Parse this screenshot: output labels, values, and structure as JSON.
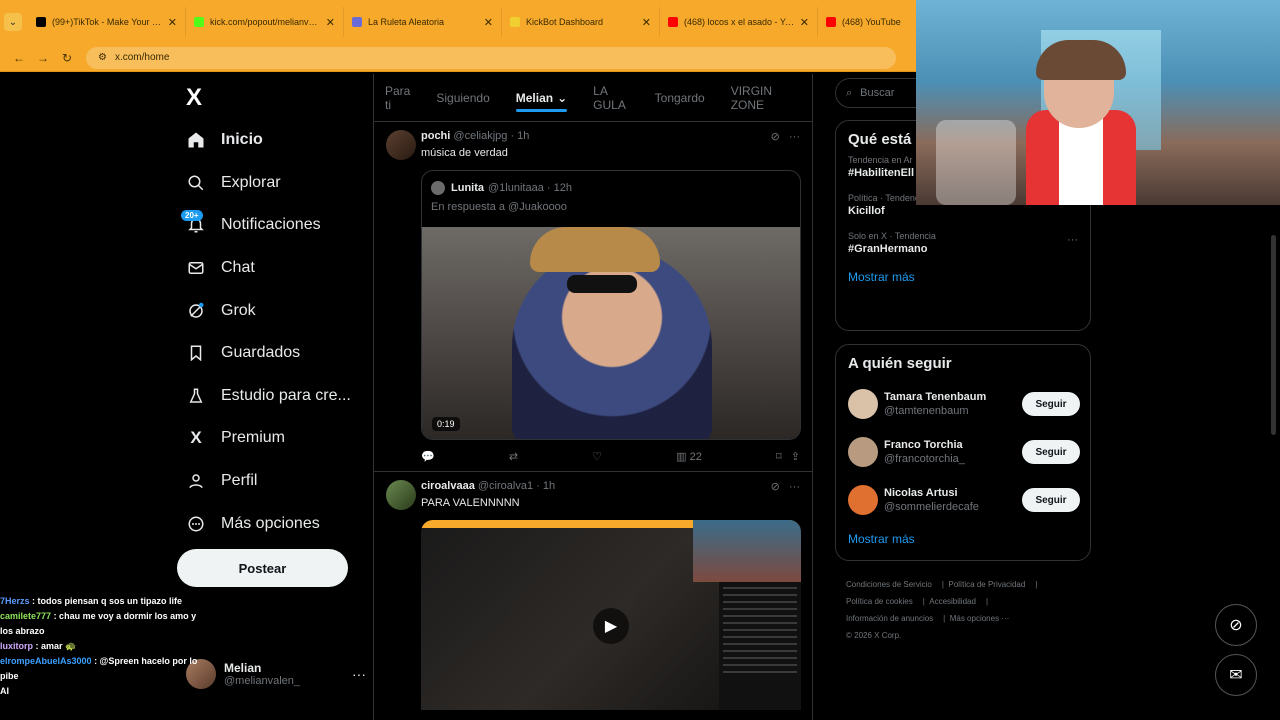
{
  "browser": {
    "tabs": [
      {
        "title": "(99+)TikTok - Make Your Day",
        "color": "#000000"
      },
      {
        "title": "kick.com/popout/melianvalen/",
        "color": "#53fc18"
      },
      {
        "title": "La Ruleta Aleatoria",
        "color": "#6b6bd8"
      },
      {
        "title": "KickBot Dashboard",
        "color": "#f0d030"
      },
      {
        "title": "(468) locos x el asado - YouTube",
        "color": "#ff0000"
      },
      {
        "title": "(468) YouTube",
        "color": "#ff0000"
      }
    ],
    "url": "x.com/home"
  },
  "sidebar": {
    "logo": "X",
    "items": [
      {
        "label": "Inicio",
        "icon": "home-icon",
        "glyph": "⌂"
      },
      {
        "label": "Explorar",
        "icon": "search-icon",
        "glyph": "⌕"
      },
      {
        "label": "Notificaciones",
        "icon": "bell-icon",
        "glyph": "🔔",
        "badge": "20+"
      },
      {
        "label": "Chat",
        "icon": "mail-icon",
        "glyph": "✉"
      },
      {
        "label": "Grok",
        "icon": "grok-icon",
        "glyph": "⊘"
      },
      {
        "label": "Guardados",
        "icon": "bookmark-icon",
        "glyph": "⌑"
      },
      {
        "label": "Estudio para cre...",
        "icon": "flask-icon",
        "glyph": "⚗"
      },
      {
        "label": "Premium",
        "icon": "x-logo-icon",
        "glyph": "X"
      },
      {
        "label": "Perfil",
        "icon": "person-icon",
        "glyph": "👤"
      },
      {
        "label": "Más opciones",
        "icon": "more-circle-icon",
        "glyph": "⋯"
      }
    ],
    "post_label": "Postear",
    "profile": {
      "name": "Melian",
      "handle": "@melianvalen_",
      "more": "···"
    }
  },
  "chat_overlay": [
    {
      "user": "7Herzs",
      "text": ": todos piensan q sos un tipazo life"
    },
    {
      "user": "camilete777",
      "text": ": chau me voy a dormir los amo y los abrazo"
    },
    {
      "user": "luxitorp",
      "text": ": amar 🐢"
    },
    {
      "user": "elrompeAbuelAs3000",
      "text": ": @Spreen hacelo por lo pibe"
    },
    {
      "user": "",
      "text": "AI"
    }
  ],
  "feed": {
    "tabs": [
      "Para ti",
      "Siguiendo",
      "Melian",
      "LA GULA",
      "Tongardo",
      "VIRGIN ZONE"
    ],
    "active_tab": "Melian",
    "tweets": [
      {
        "name": "pochi",
        "handle": "@celiakjpg",
        "time": "· 1h",
        "text": "música de verdad",
        "quote": {
          "name": "Lunita",
          "handle": "@1lunitaaa",
          "time": "· 12h",
          "reply": "En respuesta a @Juakoooo",
          "duration": "0:19"
        },
        "actions": {
          "reply": "",
          "repost": "",
          "like": "",
          "views": "22"
        }
      },
      {
        "name": "ciroalvaaa",
        "handle": "@ciroalva1",
        "time": "· 1h",
        "text": "PARA VALENNNNN"
      }
    ]
  },
  "right": {
    "search_placeholder": "Buscar",
    "trends_title": "Qué está p",
    "trends": [
      {
        "category": "Tendencia en Ar",
        "name": "#HabilitenEll"
      },
      {
        "category": "Política · Tendencia",
        "name": "Kicillof"
      },
      {
        "category": "Solo en X · Tendencia",
        "name": "#GranHermano"
      }
    ],
    "trends_more": "Mostrar más",
    "follow_title": "A quién seguir",
    "follow": [
      {
        "name": "Tamara Tenenbaum",
        "handle": "@tamtenenbaum",
        "button": "Seguir",
        "color": "#d9c2a8"
      },
      {
        "name": "Franco Torchia",
        "handle": "@francotorchia_",
        "button": "Seguir",
        "color": "#b89a80"
      },
      {
        "name": "Nicolas Artusi",
        "handle": "@sommelierdecafe",
        "button": "Seguir",
        "color": "#e07030"
      }
    ],
    "follow_more": "Mostrar más",
    "footer": [
      "Condiciones de Servicio",
      "Política de Privacidad",
      "Política de cookies",
      "Accesibilidad",
      "Información de anuncios",
      "Más opciones ···",
      "© 2026 X Corp."
    ]
  }
}
